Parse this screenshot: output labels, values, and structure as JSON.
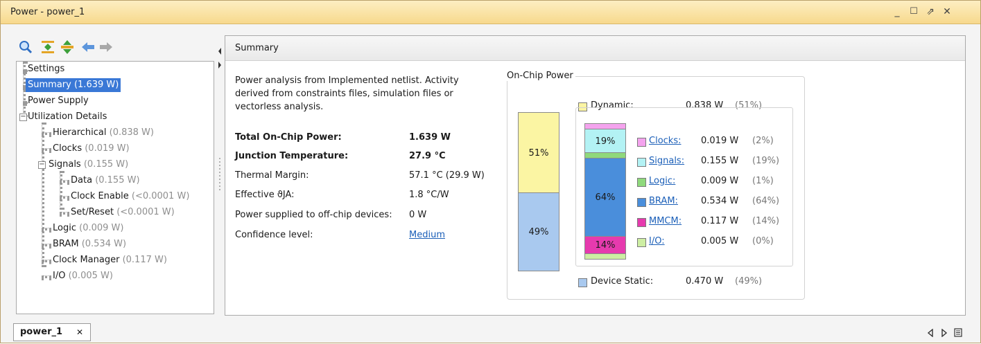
{
  "window": {
    "title": "Power - power_1",
    "controls": {
      "minimize": "_",
      "maximize": "☐",
      "restore": "⇗",
      "close": "✕"
    }
  },
  "toolbar": {
    "icons": [
      "search-icon",
      "collapse-all-icon",
      "expand-all-icon",
      "back-arrow-icon",
      "forward-arrow-icon"
    ]
  },
  "tree": {
    "settings": "Settings",
    "summary": {
      "label": "Summary",
      "value": "(1.639 W)"
    },
    "power_supply": "Power Supply",
    "utilization": "Utilization Details",
    "hierarchical": {
      "label": "Hierarchical",
      "value": "(0.838 W)"
    },
    "clocks": {
      "label": "Clocks",
      "value": "(0.019 W)"
    },
    "signals": {
      "label": "Signals",
      "value": "(0.155 W)"
    },
    "data": {
      "label": "Data",
      "value": "(0.155 W)"
    },
    "clock_enable": {
      "label": "Clock Enable",
      "value": "(<0.0001 W)"
    },
    "set_reset": {
      "label": "Set/Reset",
      "value": "(<0.0001 W)"
    },
    "logic": {
      "label": "Logic",
      "value": "(0.009 W)"
    },
    "bram": {
      "label": "BRAM",
      "value": "(0.534 W)"
    },
    "clock_manager": {
      "label": "Clock Manager",
      "value": "(0.117 W)"
    },
    "io": {
      "label": "I/O",
      "value": "(0.005 W)"
    }
  },
  "summary": {
    "header": "Summary",
    "description": "Power analysis from Implemented netlist. Activity derived from constraints files, simulation files or vectorless analysis.",
    "rows": [
      {
        "label": "Total On-Chip Power:",
        "value": "1.639 W"
      },
      {
        "label": "Junction Temperature:",
        "value": "27.9 °C"
      },
      {
        "label": "Thermal Margin:",
        "value": "57.1 °C (29.9 W)"
      },
      {
        "label": "Effective ϑJA:",
        "value": "1.8 °C/W"
      },
      {
        "label": "Power supplied to off-chip devices:",
        "value": "0 W"
      },
      {
        "label": "Confidence level:",
        "value": "Medium"
      }
    ]
  },
  "on_chip": {
    "title": "On-Chip Power",
    "dynamic": {
      "label": "Dynamic:",
      "value": "0.838 W",
      "pct": "(51%)",
      "bar_pct": "51%",
      "fraction": 0.51,
      "color": "#fbf5a3"
    },
    "static": {
      "label": "Device Static:",
      "value": "0.470 W",
      "pct": "(49%)",
      "bar_pct": "49%",
      "fraction": 0.49,
      "color": "#a9c9ef"
    },
    "components": [
      {
        "label": "Clocks:",
        "value": "0.019 W",
        "pct": "(2%)",
        "color": "#f4a3ee",
        "fraction": 0.02
      },
      {
        "label": "Signals:",
        "value": "0.155 W",
        "pct": "(19%)",
        "color": "#b3f2f4",
        "fraction": 0.19,
        "bar_label": "19%"
      },
      {
        "label": "Logic:",
        "value": "0.009 W",
        "pct": "(1%)",
        "color": "#8fd97c",
        "fraction": 0.01
      },
      {
        "label": "BRAM:",
        "value": "0.534 W",
        "pct": "(64%)",
        "color": "#4a8edb",
        "fraction": 0.64,
        "bar_label": "64%"
      },
      {
        "label": "MMCM:",
        "value": "0.117 W",
        "pct": "(14%)",
        "color": "#e63aae",
        "fraction": 0.14,
        "bar_label": "14%"
      },
      {
        "label": "I/O:",
        "value": "0.005 W",
        "pct": "(0%)",
        "color": "#cdeea3",
        "fraction": 0.0
      }
    ]
  },
  "bottom": {
    "tab_label": "power_1",
    "tab_close": "✕",
    "nav_icons": [
      "left-arrow-icon",
      "right-arrow-icon",
      "list-icon"
    ]
  }
}
